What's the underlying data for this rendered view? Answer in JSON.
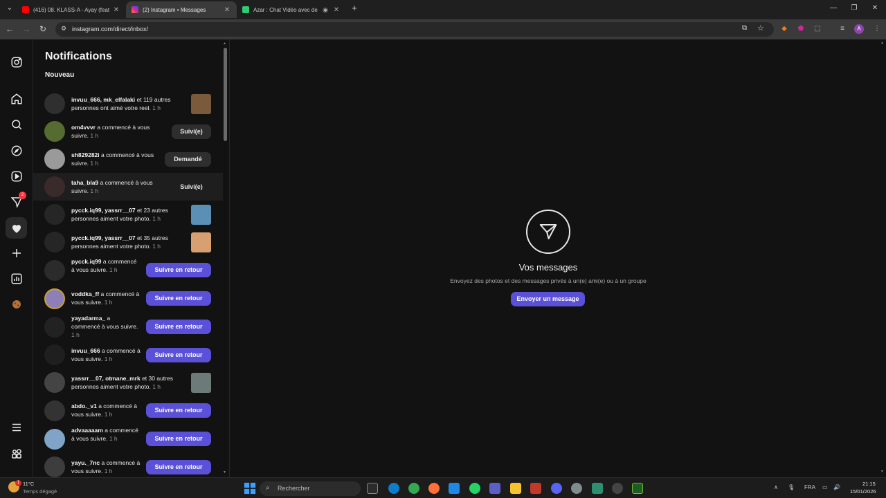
{
  "browser": {
    "tabs": [
      {
        "label": "(416) 08. KLASS-A - Ayay (feat.",
        "favicon_color": "#ff0000"
      },
      {
        "label": "(2) Instagram • Messages",
        "favicon_color": "#d6249f"
      },
      {
        "label": "Azar : Chat Vidéo avec de n",
        "favicon_color": "#2ecc71"
      }
    ],
    "new_tab_label": "+",
    "url": "instagram.com/direct/inbox/",
    "profile_initial": "A"
  },
  "nav": {
    "badge_count": "2"
  },
  "notifications": {
    "title": "Notifications",
    "section": "Nouveau",
    "items": [
      {
        "user": "invuu_666, mk_elfalaki",
        "text": " et 119 autres personnes ont aimé votre reel.",
        "time": " 1 h",
        "action_type": "thumb",
        "thumb_color": "#7a5a3a"
      },
      {
        "user": "om4vvvr",
        "text": " a commencé à vous suivre.",
        "time": " 1 h",
        "action_type": "grey",
        "action": "Suivi(e)"
      },
      {
        "user": "sh829282i",
        "text": " a commencé à vous suivre.",
        "time": " 1 h",
        "action_type": "grey",
        "action": "Demandé"
      },
      {
        "user": "taha_bla9",
        "text": " a commencé à vous suivre.",
        "time": " 1 h",
        "action_type": "grey",
        "action": "Suivi(e)"
      },
      {
        "user": "pycck.iq99, yassrr__07",
        "text": " et 23 autres personnes aiment votre photo.",
        "time": " 1 h",
        "action_type": "thumb",
        "thumb_color": "#5b8fb5"
      },
      {
        "user": "pycck.iq99, yassrr__07",
        "text": " et 35 autres personnes aiment votre photo.",
        "time": " 1 h",
        "action_type": "thumb",
        "thumb_color": "#d8a070"
      },
      {
        "user": "pycck.iq99",
        "text": " a commencé à vous suivre.",
        "time": " 1 h",
        "action_type": "blue",
        "action": "Suivre en retour"
      },
      {
        "user": "voddka_ff",
        "text": " a commencé à vous suivre.",
        "time": " 1 h",
        "action_type": "blue",
        "action": "Suivre en retour"
      },
      {
        "user": "yayadarma_",
        "text": " a commencé à vous suivre.",
        "time": " 1 h",
        "action_type": "blue",
        "action": "Suivre en retour"
      },
      {
        "user": "invuu_666",
        "text": " a commencé à vous suivre.",
        "time": " 1 h",
        "action_type": "blue",
        "action": "Suivre en retour"
      },
      {
        "user": "yassrr__07, otmane_mrk",
        "text": " et 30 autres personnes aiment votre photo.",
        "time": " 1 h",
        "action_type": "thumb",
        "thumb_color": "#6c7a78"
      },
      {
        "user": "abdo._v1",
        "text": " a commencé à vous suivre.",
        "time": " 1 h",
        "action_type": "blue",
        "action": "Suivre en retour"
      },
      {
        "user": "advaaaaam",
        "text": " a commencé à vous suivre.",
        "time": " 1 h",
        "action_type": "blue",
        "action": "Suivre en retour"
      },
      {
        "user": "yayu._7nc",
        "text": " a commencé à vous suivre.",
        "time": " 1 h",
        "action_type": "blue",
        "action": "Suivre en retour"
      }
    ]
  },
  "messages": {
    "title": "Vos messages",
    "subtitle": "Envoyez des photos et des messages privés à un(e) ami(e) ou à un groupe",
    "button": "Envoyer un message"
  },
  "taskbar": {
    "weather_temp": "11°C",
    "weather_desc": "Temps dégagé",
    "weather_badge": "1",
    "search_label": "Rechercher",
    "lang": "FRA",
    "time": "21:15",
    "date": "15/01/2026"
  },
  "colors": {
    "accent": "#5b51d8",
    "background": "#121212"
  }
}
